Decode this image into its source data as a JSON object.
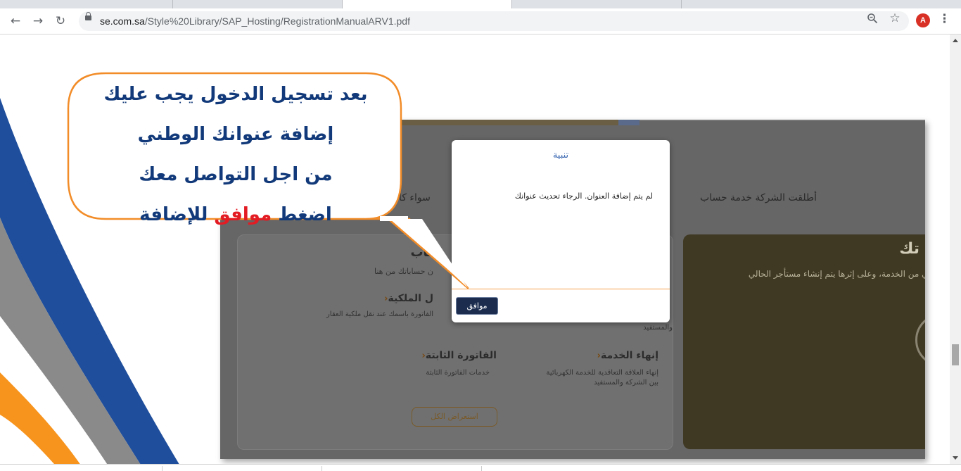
{
  "browser": {
    "url_host": "se.com.sa",
    "url_path": "/Style%20Library/SAP_Hosting/RegistrationManualARV1.pdf",
    "avatar_letter": "A"
  },
  "page": {
    "intro_text": "أطلقت الشركة خدمة حساب",
    "intro_text_tail": "سواء كا",
    "left_card": {
      "heading1": "ساب",
      "sub1": "ن حساباتك من هنا",
      "heading2": "ل الملكية",
      "sub2": "الفاتورة باسمك عند نقل ملكية العقار",
      "sub2b": "والمستفيد",
      "heading3": "إنهاء الخدمة",
      "sub3a": "إنهاء العلاقة التعاقدية للخدمة الكهربائية",
      "sub3b": "بين الشركة والمستفيد",
      "heading4": "الفاتورة الثابتة",
      "sub4": "خدمات الفاتورة الثابتة",
      "show_all": "استعراض الكل"
    },
    "right_card": {
      "title": "تك",
      "text": "المستفيد الفعلي من الخدمة، وعلى إثرها يتم إنشاء مستأجر الحالي"
    },
    "dialog": {
      "title": "تنبية",
      "message": "لم يتم إضافة العنوان. الرجاء تحديث عنوانك",
      "ok_label": "موافق"
    },
    "callout": {
      "line1": "بعد تسجيل الدخول يجب عليك",
      "line2": "إضافة عنوانك الوطني",
      "line3": "من اجل التواصل معك",
      "line4_a": "اضغط",
      "line4_red": "موافق",
      "line4_b": "للإضافة"
    }
  },
  "colors": {
    "callout_text": "#123a7a",
    "callout_border": "#f28c28",
    "highlight": "#e31b23",
    "stripe_blue": "#1f4e9c",
    "stripe_gray": "#8a8a8a",
    "stripe_orange": "#f7941d"
  }
}
